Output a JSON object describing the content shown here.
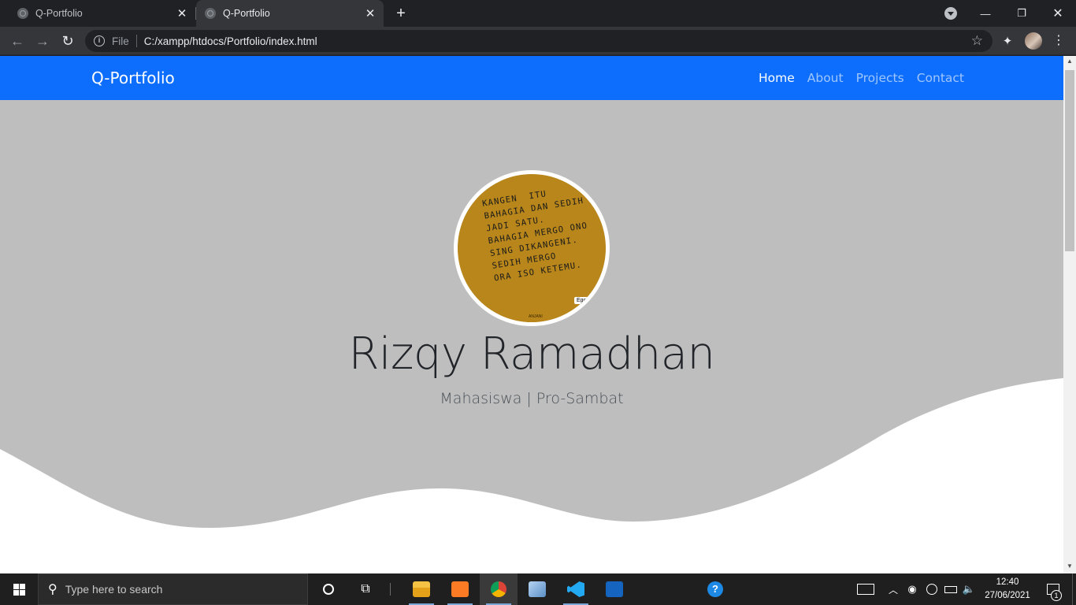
{
  "browser": {
    "tabs": [
      {
        "title": "Q-Portfolio",
        "active": false
      },
      {
        "title": "Q-Portfolio",
        "active": true
      }
    ],
    "new_tab": "+",
    "window_controls": {
      "minimize": "—",
      "maximize": "❐",
      "close": "✕"
    },
    "nav": {
      "back": "←",
      "forward": "→",
      "reload": "↻"
    },
    "omnibox": {
      "scheme_label": "File",
      "url": "C:/xampp/htdocs/Portfolio/index.html"
    },
    "icons": {
      "star": "☆",
      "extensions": "✦",
      "menu": "⋮",
      "info": "i"
    }
  },
  "site": {
    "brand": "Q-Portfolio",
    "nav_links": [
      "Home",
      "About",
      "Projects",
      "Contact"
    ],
    "active_link": "Home",
    "hero": {
      "name": "Rizqy Ramadhan",
      "subtitle": "Mahasiswa | Pro-Sambat",
      "avatar_text": "KANGEN  ITU\nBAHAGIA DAN SEDIH\nJADI SATU.\nBAHAGIA MERGO ONO\nSING DIKANGENI.\nSEDIH MERGO\nORA ISO KETEMU.",
      "avatar_tag": "Ego",
      "avatar_signature": "ANJANI"
    },
    "colors": {
      "navbar": "#0d6efd",
      "hero_bg": "#bebebe",
      "avatar_bg": "#b8861a"
    }
  },
  "taskbar": {
    "search_placeholder": "Type here to search",
    "clock_time": "12:40",
    "clock_date": "27/06/2021",
    "notification_count": "1",
    "apps": [
      "file-explorer",
      "xampp",
      "chrome",
      "virtualbox",
      "vscode",
      "movies-tv",
      "help"
    ]
  }
}
